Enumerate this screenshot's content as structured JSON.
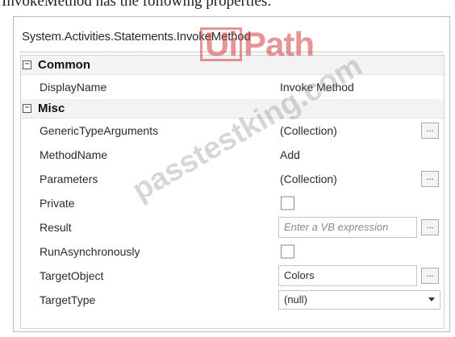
{
  "caption": "InvokeMethod has the following properties:",
  "panel": {
    "title": "System.Activities.Statements.InvokeMethod"
  },
  "categories": [
    {
      "toggle": "⊟",
      "label": "Common"
    },
    {
      "toggle": "⊟",
      "label": "Misc"
    }
  ],
  "properties": {
    "display_name": {
      "name": "DisplayName",
      "value": "Invoke Method"
    },
    "generic_type_arguments": {
      "name": "GenericTypeArguments",
      "value": "(Collection)",
      "button": "..."
    },
    "method_name": {
      "name": "MethodName",
      "value": "Add"
    },
    "parameters": {
      "name": "Parameters",
      "value": "(Collection)",
      "button": "..."
    },
    "private": {
      "name": "Private",
      "checked": false
    },
    "result": {
      "name": "Result",
      "placeholder": "Enter a VB expression",
      "button": "..."
    },
    "run_asynchronously": {
      "name": "RunAsynchronously",
      "checked": false
    },
    "target_object": {
      "name": "TargetObject",
      "value": "Colors",
      "button": "..."
    },
    "target_type": {
      "name": "TargetType",
      "value": "(null)"
    }
  },
  "watermarks": {
    "logo_text": "UiPath",
    "site_text": "passtestking.com"
  },
  "colors": {
    "watermark_logo": "#d63c3c",
    "category_bg": "#f3f3f3",
    "border": "#b9b9b9"
  }
}
